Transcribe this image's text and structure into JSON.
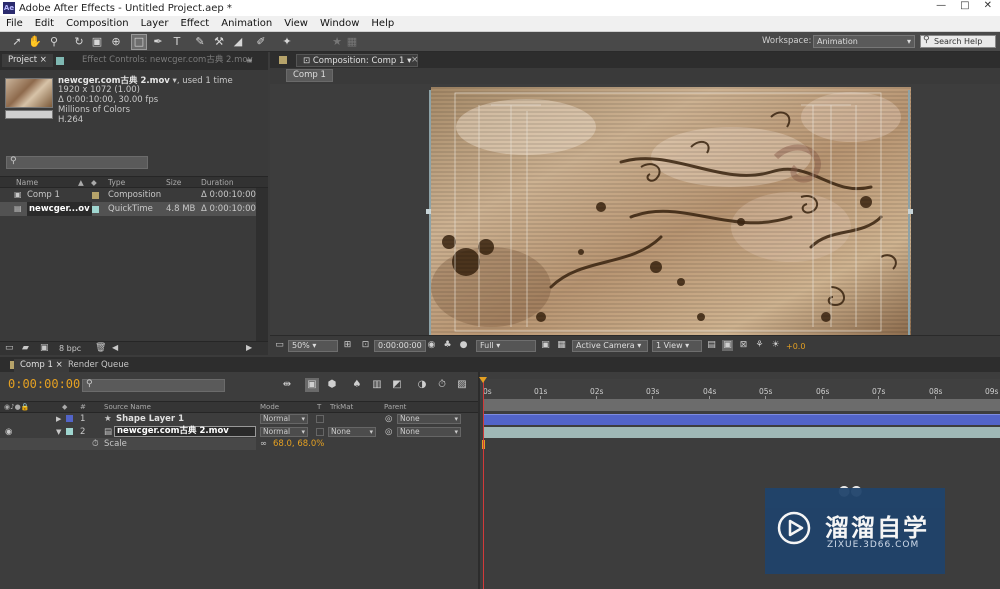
{
  "window": {
    "app_icon": "Ae",
    "title": "Adobe After Effects - Untitled Project.aep *",
    "controls": [
      "—",
      "□",
      "✕"
    ]
  },
  "menu": [
    "File",
    "Edit",
    "Composition",
    "Layer",
    "Effect",
    "Animation",
    "View",
    "Window",
    "Help"
  ],
  "toolbar": {
    "tools": [
      "selection-tool-icon",
      "hand-tool-icon",
      "zoom-tool-icon",
      "rotate-tool-icon",
      "camera-tool-icon",
      "pan-behind-tool-icon",
      "rectangle-tool-icon",
      "pen-tool-icon",
      "type-tool-icon",
      "brush-tool-icon",
      "clone-stamp-tool-icon",
      "eraser-tool-icon",
      "roto-brush-tool-icon",
      "puppet-pin-tool-icon"
    ],
    "workspace_label": "Workspace:",
    "workspace_value": "Animation",
    "search_placeholder": "Search Help"
  },
  "project": {
    "tab_project": "Project",
    "tab_effects": "Effect Controls: newcger.com古典 2.mov",
    "info_name": "newcger.com古典 2.mov",
    "info_used": ", used 1 time",
    "info_size": "1920 x 1072 (1.00)",
    "info_duration": "Δ 0:00:10:00, 30.00 fps",
    "info_colors": "Millions of Colors",
    "info_codec": "H.264",
    "columns": {
      "name": "Name",
      "type": "Type",
      "size": "Size",
      "duration": "Duration"
    },
    "items": [
      {
        "name": "Comp 1",
        "type": "Composition",
        "size": "",
        "duration": "Δ 0:00:10:00",
        "color": "#b6a36a"
      },
      {
        "name": "newcger...ov",
        "type": "QuickTime",
        "size": "4.8 MB",
        "duration": "Δ 0:00:10:00",
        "color": "#9fd6d0"
      }
    ],
    "bpc": "8 bpc"
  },
  "comp": {
    "tab": "Composition: Comp 1",
    "breadcrumb": "Comp 1",
    "zoom": "50%",
    "timecode": "0:00:00:00",
    "resolution": "Full",
    "camera": "Active Camera",
    "views": "1 View",
    "exposure": "+0.0"
  },
  "timeline": {
    "tab_comp": "Comp 1",
    "tab_render": "Render Queue",
    "timecode": "0:00:00:00",
    "header": {
      "num": "#",
      "source": "Source Name",
      "mode": "Mode",
      "t": "T",
      "trkmat": "TrkMat",
      "parent": "Parent"
    },
    "layers": [
      {
        "num": "1",
        "name": "Shape Layer 1",
        "mode": "Normal",
        "trkmat": "",
        "parent": "None"
      },
      {
        "num": "2",
        "name": "newcger.com古典 2.mov",
        "mode": "Normal",
        "trkmat": "None",
        "parent": "None"
      }
    ],
    "property": {
      "name": "Scale",
      "value": "68.0, 68.0%"
    },
    "ruler": [
      "0s",
      "01s",
      "02s",
      "03s",
      "04s",
      "05s",
      "06s",
      "07s",
      "08s",
      "09s"
    ]
  },
  "watermark": {
    "title": "溜溜自学",
    "sub": "ZIXUE.3D66.COM"
  },
  "colors": {
    "timecode": "#e4a022",
    "shape_track": "#5264c8",
    "footage_track": "#9fb8b6",
    "playhead": "#d23a3a",
    "watermark_bg": "#20436b"
  }
}
